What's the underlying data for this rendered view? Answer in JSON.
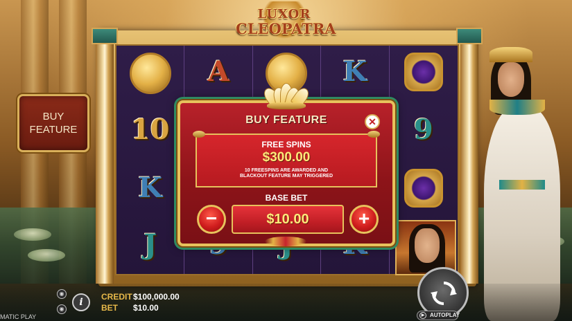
{
  "game": {
    "logo_line1": "LUXOR",
    "logo_line2": "CLEOPATRA"
  },
  "reels": {
    "columns": [
      [
        {
          "type": "coin",
          "icon": "scarab-coin-icon"
        },
        {
          "type": "text",
          "text": "10",
          "color": "gold"
        },
        {
          "type": "text",
          "text": "K",
          "color": "blue"
        },
        {
          "type": "text",
          "text": "J",
          "color": "teal"
        }
      ],
      [
        {
          "type": "text",
          "text": "A",
          "color": "red"
        },
        {
          "type": "text",
          "text": "",
          "color": "gold"
        },
        {
          "type": "text",
          "text": "",
          "color": "gold"
        },
        {
          "type": "text",
          "text": "9",
          "color": "blue"
        }
      ],
      [
        {
          "type": "coin",
          "icon": "gold-coin-icon"
        },
        {
          "type": "text",
          "text": "",
          "color": "gold"
        },
        {
          "type": "text",
          "text": "",
          "color": "gold"
        },
        {
          "type": "text",
          "text": "J",
          "color": "teal"
        }
      ],
      [
        {
          "type": "text",
          "text": "K",
          "color": "blue"
        },
        {
          "type": "text",
          "text": "",
          "color": "gold"
        },
        {
          "type": "text",
          "text": "",
          "color": "gold"
        },
        {
          "type": "text",
          "text": "K",
          "color": "blue"
        }
      ],
      [
        {
          "type": "ring",
          "icon": "ankh-ring-icon"
        },
        {
          "type": "text",
          "text": "9",
          "color": "teal"
        },
        {
          "type": "ring",
          "icon": "ankh-ring-icon"
        },
        {
          "type": "portrait",
          "icon": "cleopatra-portrait-icon"
        }
      ]
    ]
  },
  "buy_feature_button": {
    "label_line1": "BUY",
    "label_line2": "FEATURE"
  },
  "modal": {
    "title": "BUY FEATURE",
    "close_icon": "close-icon",
    "free_spins_label": "FREE SPINS",
    "free_spins_price": "$300.00",
    "note_line1": "10 FREESPINS ARE AWARDED AND",
    "note_line2": "BLACKOUT FEATURE MAY TRIGGERED",
    "base_bet_label": "BASE BET",
    "bet_value": "$10.00",
    "minus_label": "−",
    "plus_label": "+"
  },
  "bottom": {
    "credit_label": "CREDIT",
    "credit_value": "$100,000.00",
    "bet_label": "BET",
    "bet_value": "$10.00",
    "info_label": "i",
    "provider": "MATIC PLAY",
    "autoplay_label": "AUTOPLAY"
  },
  "colors": {
    "modal_red": "#b8212a",
    "gold_border": "#e7c25c",
    "price_yellow": "#ffe87a",
    "credit_label": "#e8b94a"
  }
}
